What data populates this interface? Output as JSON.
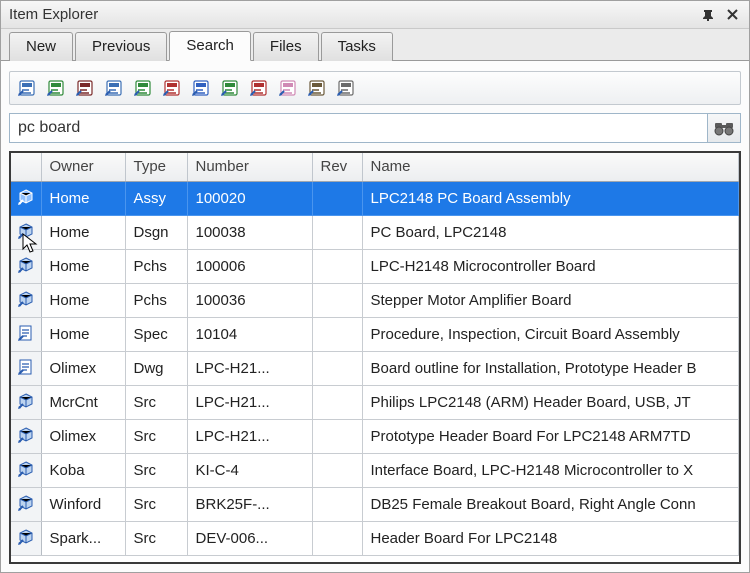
{
  "window": {
    "title": "Item Explorer",
    "pin_glyph": "⊓",
    "close_glyph": "✕"
  },
  "tabs": [
    {
      "label": "New",
      "active": false
    },
    {
      "label": "Previous",
      "active": false
    },
    {
      "label": "Search",
      "active": true
    },
    {
      "label": "Files",
      "active": false
    },
    {
      "label": "Tasks",
      "active": false
    }
  ],
  "toolbar_icons": [
    "filter-assy-icon",
    "filter-green-icon",
    "filter-maroon-icon",
    "filter-doc-icon",
    "filter-check-icon",
    "filter-xred-icon",
    "filter-bluearrow-icon",
    "filter-checkdoc-icon",
    "filter-xdoc-icon",
    "filter-pink-icon",
    "filter-home-icon",
    "filter-factory-icon"
  ],
  "toolbar_colors": [
    "#3b6fb5",
    "#2f8a3a",
    "#7a2a2a",
    "#3b6fb5",
    "#2f8a3a",
    "#b03030",
    "#3060c0",
    "#2f8a3a",
    "#b03030",
    "#d08ab5",
    "#6b5a3a",
    "#6b6b6b"
  ],
  "search": {
    "value": "pc board",
    "btn_name": "search-run-button",
    "btn_glyph": "binoculars-icon"
  },
  "columns": {
    "icon": "",
    "owner": "Owner",
    "type": "Type",
    "number": "Number",
    "rev": "Rev",
    "name": "Name"
  },
  "rows": [
    {
      "sel": true,
      "icon": "cube-blue",
      "owner": "Home",
      "type": "Assy",
      "number": "100020",
      "rev": "",
      "name": "LPC2148 PC Board Assembly"
    },
    {
      "sel": false,
      "icon": "cube-blue",
      "owner": "Home",
      "type": "Dsgn",
      "number": "100038",
      "rev": "",
      "name": "PC Board, LPC2148"
    },
    {
      "sel": false,
      "icon": "cube-blue",
      "owner": "Home",
      "type": "Pchs",
      "number": "100006",
      "rev": "",
      "name": "LPC-H2148 Microcontroller Board"
    },
    {
      "sel": false,
      "icon": "cube-blue",
      "owner": "Home",
      "type": "Pchs",
      "number": "100036",
      "rev": "",
      "name": "Stepper Motor Amplifier Board"
    },
    {
      "sel": false,
      "icon": "doc-blue",
      "owner": "Home",
      "type": "Spec",
      "number": "10104",
      "rev": "",
      "name": "Procedure, Inspection, Circuit Board Assembly"
    },
    {
      "sel": false,
      "icon": "doc-blue",
      "owner": "Olimex",
      "type": "Dwg",
      "number": "LPC-H21...",
      "rev": "",
      "name": "Board outline for Installation, Prototype Header B"
    },
    {
      "sel": false,
      "icon": "cube-blue",
      "owner": "McrCnt",
      "type": "Src",
      "number": "LPC-H21...",
      "rev": "",
      "name": "Philips LPC2148 (ARM) Header Board, USB, JT"
    },
    {
      "sel": false,
      "icon": "cube-blue",
      "owner": "Olimex",
      "type": "Src",
      "number": "LPC-H21...",
      "rev": "",
      "name": "Prototype Header Board For LPC2148 ARM7TD"
    },
    {
      "sel": false,
      "icon": "cube-blue",
      "owner": "Koba",
      "type": "Src",
      "number": "KI-C-4",
      "rev": "",
      "name": "Interface Board, LPC-H2148 Microcontroller to X"
    },
    {
      "sel": false,
      "icon": "cube-blue",
      "owner": "Winford",
      "type": "Src",
      "number": "BRK25F-...",
      "rev": "",
      "name": "DB25 Female Breakout Board, Right Angle Conn"
    },
    {
      "sel": false,
      "icon": "cube-blue",
      "owner": "Spark...",
      "type": "Src",
      "number": "DEV-006...",
      "rev": "",
      "name": "Header Board For LPC2148"
    }
  ]
}
